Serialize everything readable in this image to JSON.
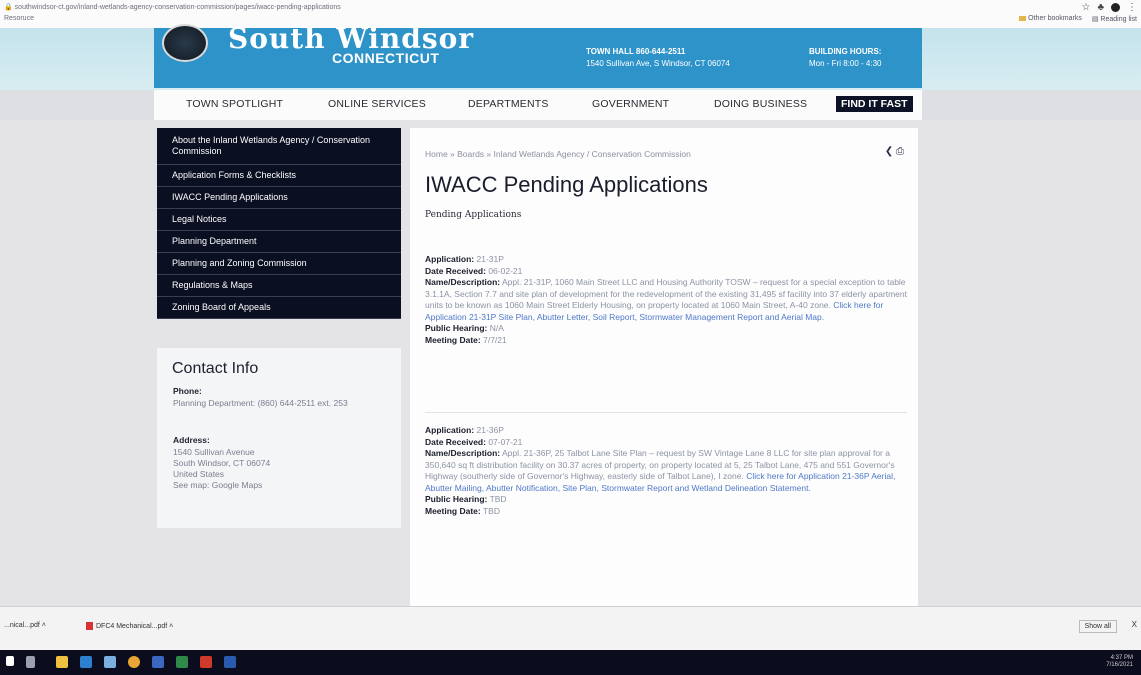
{
  "browser": {
    "url": "southwindsor-ct.gov/inland-wetlands-agency-conservation-commission/pages/iwacc-pending-applications",
    "bookmarks_left": "Resoruce",
    "bookmarks_right": [
      "Other bookmarks",
      "Reading list"
    ]
  },
  "header": {
    "brand": "South Windsor",
    "brand_sub": "CONNECTICUT",
    "townhall_label": "TOWN HALL 860-644-2511",
    "townhall_address": "1540 Sullivan Ave, S Windsor, CT 06074",
    "hours_label": "BUILDING HOURS:",
    "hours_value": "Mon - Fri 8:00 - 4:30"
  },
  "nav": {
    "items": [
      "TOWN SPOTLIGHT",
      "ONLINE SERVICES",
      "DEPARTMENTS",
      "GOVERNMENT",
      "DOING BUSINESS"
    ],
    "find_label": "FIND IT FAST"
  },
  "sidebar": {
    "items": [
      {
        "label": "About the Inland Wetlands Agency / Conservation Commission"
      },
      {
        "label": "Application Forms & Checklists"
      },
      {
        "label": "IWACC Pending Applications"
      },
      {
        "label": "Legal Notices"
      },
      {
        "label": "Planning Department"
      },
      {
        "label": "Planning and Zoning Commission"
      },
      {
        "label": "Regulations & Maps"
      },
      {
        "label": "Zoning Board of Appeals"
      }
    ]
  },
  "contact": {
    "title": "Contact Info",
    "phone_label": "Phone:",
    "phone_value": "Planning Department: (860) 644-2511 ext. 253",
    "address_label": "Address:",
    "address_lines": [
      "1540 Sullivan Avenue",
      "South Windsor, CT 06074",
      "United States"
    ],
    "map_link": "See map: Google Maps"
  },
  "main": {
    "breadcrumb": "Home » Boards » Inland Wetlands Agency / Conservation Commission",
    "title": "IWACC Pending Applications",
    "subtitle": "Pending Applications",
    "applications": [
      {
        "application_label": "Application:",
        "application_value": "21-31P",
        "date_label": "Date Received:",
        "date_value": "06-02-21",
        "desc_label": "Name/Description:",
        "desc_text": "Appl. 21-31P, 1060 Main Street LLC and Housing Authority TOSW – request for a special exception to table 3.1.1A, Section 7.7 and site plan of development for the redevelopment of the existing 31,495 sf facility into 37 elderly apartment units to be known as 1060 Main Street Elderly Housing, on property located at 1060 Main Street, A-40 zone.",
        "desc_link": "Click here for Application 21-31P Site Plan, Abutter Letter, Soil Report, Stormwater Management Report and Aerial Map.",
        "hearing_label": "Public Hearing:",
        "hearing_value": "N/A",
        "meeting_label": "Meeting Date:",
        "meeting_value": "7/7/21"
      },
      {
        "application_label": "Application:",
        "application_value": "21-36P",
        "date_label": "Date Received:",
        "date_value": "07-07-21",
        "desc_label": "Name/Description:",
        "desc_text": "Appl. 21-36P, 25 Talbot Lane Site Plan – request by SW Vintage Lane 8 LLC for site plan approval for a 350,640 sq ft distribution facility on 30.37 acres of property, on property located at 5, 25 Talbot Lane, 475 and 551 Governor's Highway (southerly side of Governor's Highway, easterly side of Talbot Lane), I zone.",
        "desc_link": "Click here for Application 21-36P Aerial, Abutter Mailing, Abutter Notification, Site Plan, Stormwater Report and Wetland Delineation Statement.",
        "hearing_label": "Public Hearing:",
        "hearing_value": "TBD",
        "meeting_label": "Meeting Date:",
        "meeting_value": "TBD"
      }
    ]
  },
  "downloads": {
    "items": [
      "...nical...pdf",
      "DFC4 Mechanical...pdf"
    ],
    "show_all": "Show all",
    "close": "X"
  },
  "taskbar": {
    "time": "4:37 PM",
    "date": "7/16/2021"
  }
}
